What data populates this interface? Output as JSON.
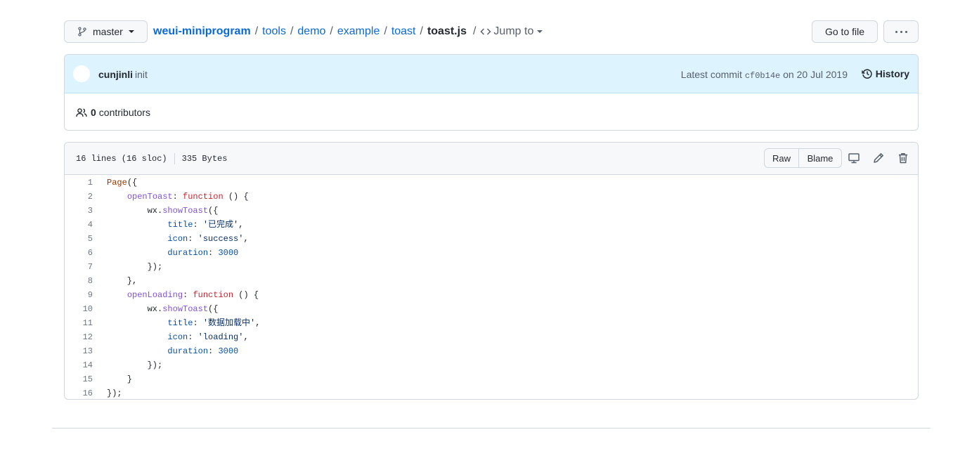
{
  "branch": {
    "name": "master",
    "icon": "git-branch-icon"
  },
  "breadcrumb": {
    "repo": "weui-miniprogram",
    "parts": [
      "tools",
      "demo",
      "example",
      "toast"
    ],
    "file": "toast.js",
    "jump_label": "Jump to"
  },
  "toolbar": {
    "go_to_file": "Go to file",
    "more_icon": "kebab-horizontal-icon"
  },
  "commit": {
    "author": "cunjinli",
    "message": "init",
    "latest_prefix": "Latest commit",
    "sha": "cf0b14e",
    "date": "on 20 Jul 2019",
    "history_label": "History"
  },
  "contributors": {
    "count": "0",
    "label": "contributors"
  },
  "file": {
    "lines_info": "16 lines (16 sloc)",
    "size": "335 Bytes",
    "raw_label": "Raw",
    "blame_label": "Blame",
    "icons": [
      "desktop-icon",
      "pencil-icon",
      "trash-icon"
    ]
  },
  "code_lines": [
    [
      [
        "tk-fn",
        "Page"
      ],
      [
        "",
        "({"
      ]
    ],
    [
      [
        "",
        "    "
      ],
      [
        "tk-prop",
        "openToast"
      ],
      [
        "",
        ": "
      ],
      [
        "tk-kw",
        "function"
      ],
      [
        "",
        " () {"
      ]
    ],
    [
      [
        "",
        "        wx."
      ],
      [
        "tk-call",
        "showToast"
      ],
      [
        "",
        "({"
      ]
    ],
    [
      [
        "",
        "            "
      ],
      [
        "tk-attr",
        "title"
      ],
      [
        "",
        ": "
      ],
      [
        "tk-str",
        "'已完成'"
      ],
      [
        "",
        ","
      ]
    ],
    [
      [
        "",
        "            "
      ],
      [
        "tk-attr",
        "icon"
      ],
      [
        "",
        ": "
      ],
      [
        "tk-str",
        "'success'"
      ],
      [
        "",
        ","
      ]
    ],
    [
      [
        "",
        "            "
      ],
      [
        "tk-attr",
        "duration"
      ],
      [
        "",
        ": "
      ],
      [
        "tk-num",
        "3000"
      ]
    ],
    [
      [
        "",
        "        });"
      ]
    ],
    [
      [
        "",
        "    },"
      ]
    ],
    [
      [
        "",
        "    "
      ],
      [
        "tk-prop",
        "openLoading"
      ],
      [
        "",
        ": "
      ],
      [
        "tk-kw",
        "function"
      ],
      [
        "",
        " () {"
      ]
    ],
    [
      [
        "",
        "        wx."
      ],
      [
        "tk-call",
        "showToast"
      ],
      [
        "",
        "({"
      ]
    ],
    [
      [
        "",
        "            "
      ],
      [
        "tk-attr",
        "title"
      ],
      [
        "",
        ": "
      ],
      [
        "tk-str",
        "'数据加载中'"
      ],
      [
        "",
        ","
      ]
    ],
    [
      [
        "",
        "            "
      ],
      [
        "tk-attr",
        "icon"
      ],
      [
        "",
        ": "
      ],
      [
        "tk-str",
        "'loading'"
      ],
      [
        "",
        ","
      ]
    ],
    [
      [
        "",
        "            "
      ],
      [
        "tk-attr",
        "duration"
      ],
      [
        "",
        ": "
      ],
      [
        "tk-num",
        "3000"
      ]
    ],
    [
      [
        "",
        "        });"
      ]
    ],
    [
      [
        "",
        "    }"
      ]
    ],
    [
      [
        "",
        "});"
      ]
    ]
  ]
}
